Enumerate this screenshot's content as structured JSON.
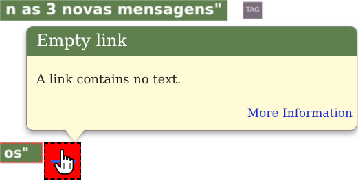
{
  "background": {
    "top_text": "n as 3 novas mensagens\"",
    "top_tag": "TAG",
    "bottom_text": "os\"",
    "accent_color": "#5f7f4f"
  },
  "tooltip": {
    "title": "Empty link",
    "message": "A link contains no text.",
    "link_label": "More Information",
    "header_color": "#5f7f4f",
    "background_color": "#fffbd6"
  },
  "error_icon": {
    "icon": "hand-pointer-icon",
    "color": "#ff0000"
  }
}
